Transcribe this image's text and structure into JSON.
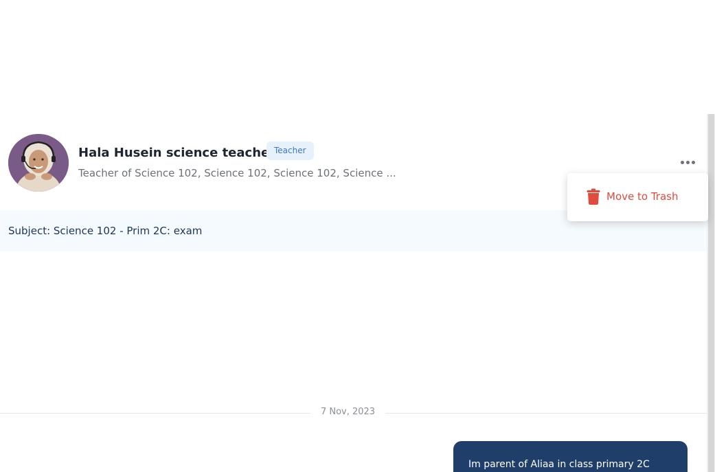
{
  "conversation": {
    "contact_name": "Hala Husein science teacher",
    "role_badge": "Teacher",
    "details": "Teacher of Science 102, Science 102, Science 102, Science ...",
    "avatar": "teacher-avatar-photo",
    "more_icon": "more-horizontal-icon"
  },
  "menu": {
    "items": [
      {
        "label": "Move to Trash",
        "icon": "trash-icon",
        "color": "#e04b3f"
      }
    ]
  },
  "subject": {
    "text": "Subject: Science 102 - Prim 2C: exam"
  },
  "messages": {
    "date_separator": "7 Nov, 2023",
    "items": [
      {
        "text": "Im parent of Aliaa in class primary 2C",
        "sender": "self"
      }
    ]
  },
  "colors": {
    "accent_navy": "#1f3f6a",
    "badge_bg": "#e6f1fc",
    "badge_text": "#3f78b9",
    "danger": "#e04b3f",
    "subject_bg": "#f5fafe"
  }
}
